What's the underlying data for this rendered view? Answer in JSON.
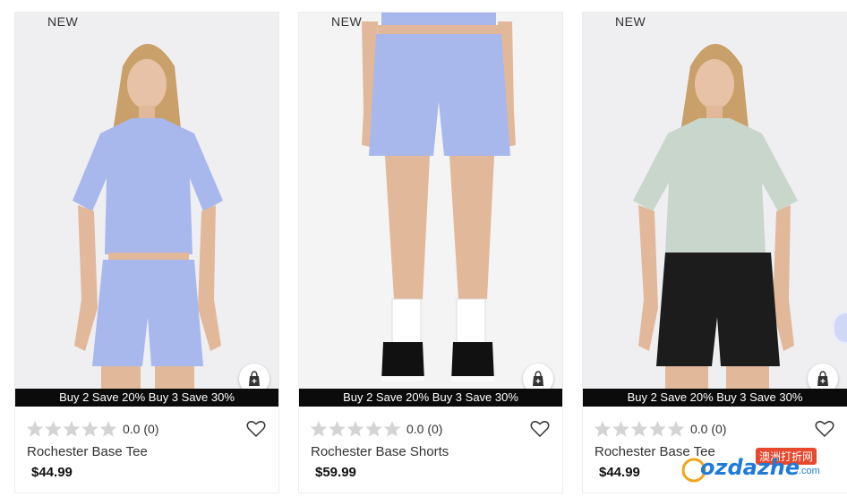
{
  "products": [
    {
      "badge": "NEW",
      "promo": "Buy 2 Save 20% Buy 3 Save 30%",
      "rating": "0.0 (0)",
      "name": "Rochester Base Tee",
      "price": "$44.99"
    },
    {
      "badge": "NEW",
      "promo": "Buy 2 Save 20% Buy 3 Save 30%",
      "rating": "0.0 (0)",
      "name": "Rochester Base Shorts",
      "price": "$59.99"
    },
    {
      "badge": "NEW",
      "promo": "Buy 2 Save 20% Buy 3 Save 30%",
      "rating": "0.0 (0)",
      "name": "Rochester Base Tee",
      "price": "$44.99"
    }
  ],
  "watermark": {
    "brand": "ozdazhe",
    "suffix": ".com",
    "chinese": "澳洲打折网"
  },
  "colors": {
    "periwinkle": "#a8b8ec",
    "sage": "#c9d6cc",
    "black_shorts": "#1c1c1c",
    "promo_bg": "#0b0b0b",
    "star_empty": "#d4d4d4"
  },
  "icons": {
    "quick_add": "shopping-bag-plus-icon",
    "wishlist": "heart-outline-icon",
    "rating": "star-icon",
    "carousel": "next-arrow-icon"
  }
}
